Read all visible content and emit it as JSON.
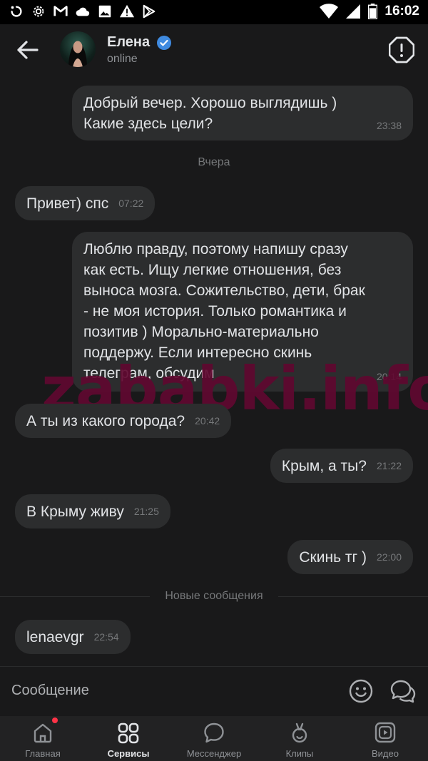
{
  "status_bar": {
    "time": "16:02",
    "left_icons": [
      "sync-icon",
      "gear-icon",
      "gmail-icon",
      "cloud-icon",
      "image-icon",
      "warning-icon",
      "play-store-icon"
    ],
    "right_icons": [
      "wifi-icon",
      "signal-icon",
      "battery-icon"
    ]
  },
  "header": {
    "contact_name": "Елена",
    "status": "online",
    "verified_color": "#3f8ae0"
  },
  "messages": [
    {
      "direction": "out",
      "lines": [
        "Добрый вечер. Хорошо выглядишь )",
        "Какие здесь цели?"
      ],
      "time": "23:38"
    },
    {
      "direction": "in",
      "lines": [
        "Привет) спс"
      ],
      "time": "07:22"
    },
    {
      "direction": "out",
      "lines": [
        "Люблю правду, поэтому напишу сразу",
        "как есть. Ищу легкие отношения, без",
        "выноса мозга. Сожительство, дети, брак",
        "- не моя история. Только романтика и",
        "позитив ) Морально-материально",
        "поддержу. Если интересно скинь",
        "телеграм, обсудим"
      ],
      "time": "20:14"
    },
    {
      "direction": "in",
      "lines": [
        "А ты из какого города?"
      ],
      "time": "20:42"
    },
    {
      "direction": "out",
      "lines": [
        "Крым, а ты?"
      ],
      "time": "21:22"
    },
    {
      "direction": "in",
      "lines": [
        "В Крыму живу"
      ],
      "time": "21:25"
    },
    {
      "direction": "out",
      "lines": [
        "Скинь тг )"
      ],
      "time": "22:00"
    },
    {
      "direction": "in",
      "lines": [
        "lenaevgr"
      ],
      "time": "22:54"
    }
  ],
  "separators": {
    "yesterday": "Вчера",
    "new_messages": "Новые сообщения"
  },
  "watermark": "zababki.info",
  "composer": {
    "placeholder": "Сообщение"
  },
  "tabs": [
    {
      "label": "Главная",
      "icon": "home-icon",
      "active": false,
      "has_notification": true
    },
    {
      "label": "Сервисы",
      "icon": "services-icon",
      "active": true,
      "has_notification": false
    },
    {
      "label": "Мессенджер",
      "icon": "messenger-icon",
      "active": false,
      "has_notification": false
    },
    {
      "label": "Клипы",
      "icon": "clips-icon",
      "active": false,
      "has_notification": false
    },
    {
      "label": "Видео",
      "icon": "video-icon",
      "active": false,
      "has_notification": false
    }
  ],
  "colors": {
    "background": "#19191a",
    "bubble": "#2c2d2e",
    "text": "#e1e3e6",
    "muted": "#76787a",
    "notification": "#ff3347",
    "watermark": "#600830"
  }
}
